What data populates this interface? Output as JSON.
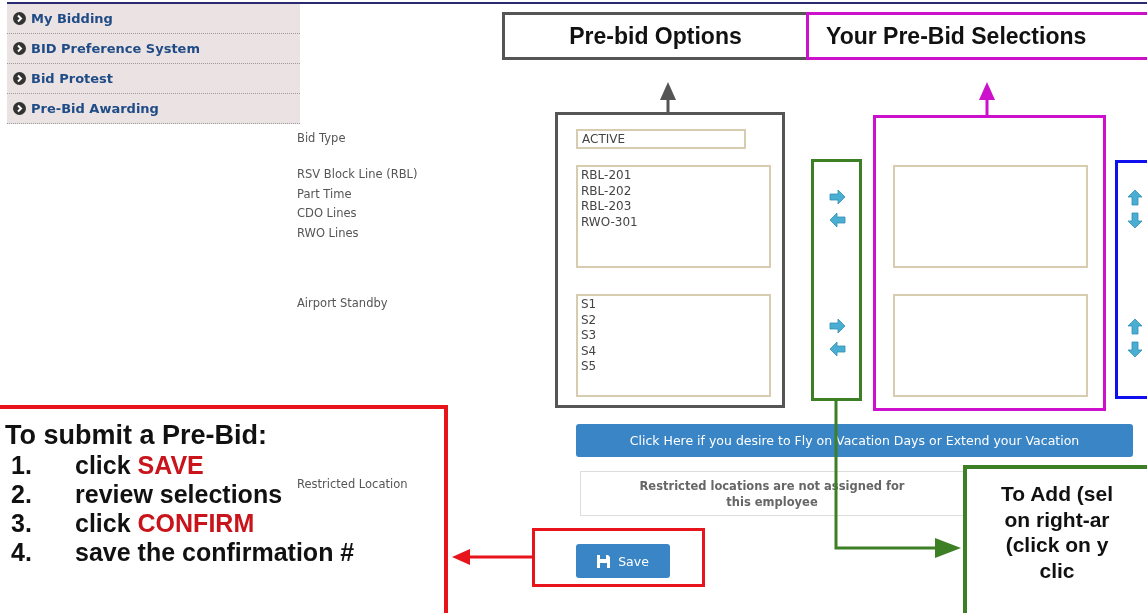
{
  "sidebar": {
    "items": [
      {
        "label": "My Bidding"
      },
      {
        "label": "BID Preference System"
      },
      {
        "label": "Bid Protest"
      },
      {
        "label": "Pre-Bid Awarding"
      }
    ]
  },
  "form": {
    "bid_type": {
      "label": "Bid Type",
      "value": "ACTIVE"
    },
    "line_groups": [
      {
        "labels": [
          "RSV Block Line (RBL)",
          "Part Time",
          "CDO Lines",
          "RWO Lines"
        ],
        "options": [
          "RBL-201",
          "RBL-202",
          "RBL-203",
          "RWO-301"
        ]
      },
      {
        "labels": [
          "Airport Standby"
        ],
        "options": [
          "S1",
          "S2",
          "S3",
          "S4",
          "S5"
        ]
      }
    ],
    "vacation_button": "Click Here if you desire to Fly on Vacation Days or Extend your Vacation",
    "restricted": {
      "label": "Restricted Location",
      "message": "Restricted locations are not assigned for this employee"
    },
    "save_button": "Save"
  },
  "annotations": {
    "options_heading": "Pre-bid Options",
    "selections_heading": "Your Pre-Bid Selections",
    "instructions": {
      "title": "To submit a Pre-Bid:",
      "steps": [
        {
          "number": "1.",
          "text": "click **SAVE**"
        },
        {
          "number": "2.",
          "text": "review selections"
        },
        {
          "number": "3.",
          "text": "click **CONFIRM**"
        },
        {
          "number": "4.",
          "text": "save the confirmation #"
        }
      ]
    },
    "add_note": [
      "To Add (sel",
      "on right-ar",
      "(click on y",
      "clic"
    ]
  }
}
